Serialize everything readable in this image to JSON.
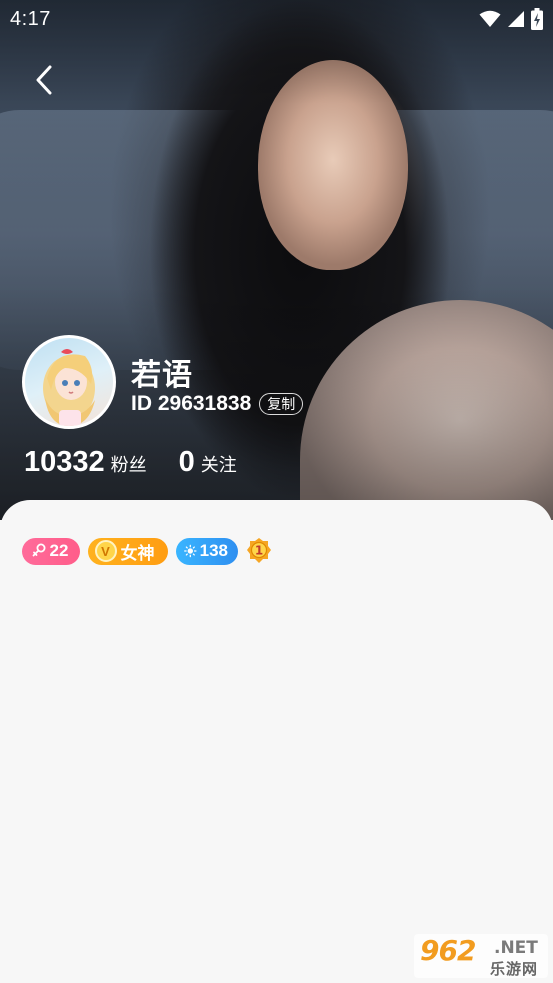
{
  "status_bar": {
    "time": "4:17",
    "icons": [
      "wifi-icon",
      "signal-icon",
      "battery-charging-icon"
    ]
  },
  "navigation": {
    "back_icon": "chevron-left-icon"
  },
  "profile": {
    "nickname": "若语",
    "id_text": "ID 29631838",
    "copy_label": "复制",
    "stats": [
      {
        "value": "10332",
        "label": "粉丝"
      },
      {
        "value": "0",
        "label": "关注"
      }
    ]
  },
  "badges": {
    "gender_icon": "female-symbol-icon",
    "age": "22",
    "vip_letter": "V",
    "vip_label": "女神",
    "level_icon": "sun-icon",
    "level": "138",
    "rank_number": "1"
  },
  "watermark": {
    "logo": "962",
    "domain": ".NET",
    "subtitle": "乐游网"
  },
  "colors": {
    "gender_badge": "#ff6b9a",
    "vip_badge": "#ffa51a",
    "level_badge": "#36a9f8",
    "sheet_background": "#f7f7f7"
  }
}
